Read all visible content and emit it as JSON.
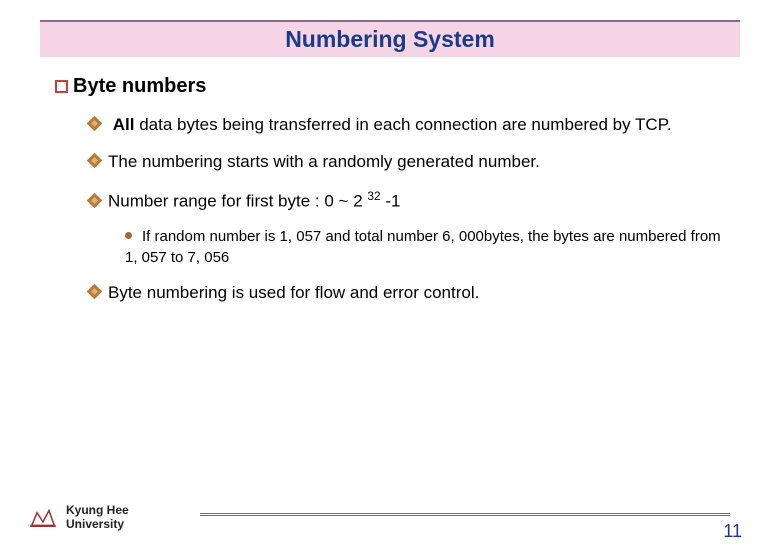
{
  "title": "Numbering System",
  "heading": "Byte numbers",
  "points": {
    "p1a": "All",
    "p1b": " data bytes being transferred in each connection are numbered by TCP.",
    "p2": "The numbering starts with a randomly generated number.",
    "p3a": "Number range for first byte : 0 ~ 2 ",
    "p3sup": "32",
    "p3b": " -1",
    "p3sub": "If random number is 1, 057 and total number 6, 000bytes, the bytes are numbered from 1, 057 to 7, 056",
    "p4": "Byte numbering is used for flow and error control."
  },
  "footer": {
    "uni1": "Kyung Hee",
    "uni2": "University"
  },
  "page_number": "11"
}
